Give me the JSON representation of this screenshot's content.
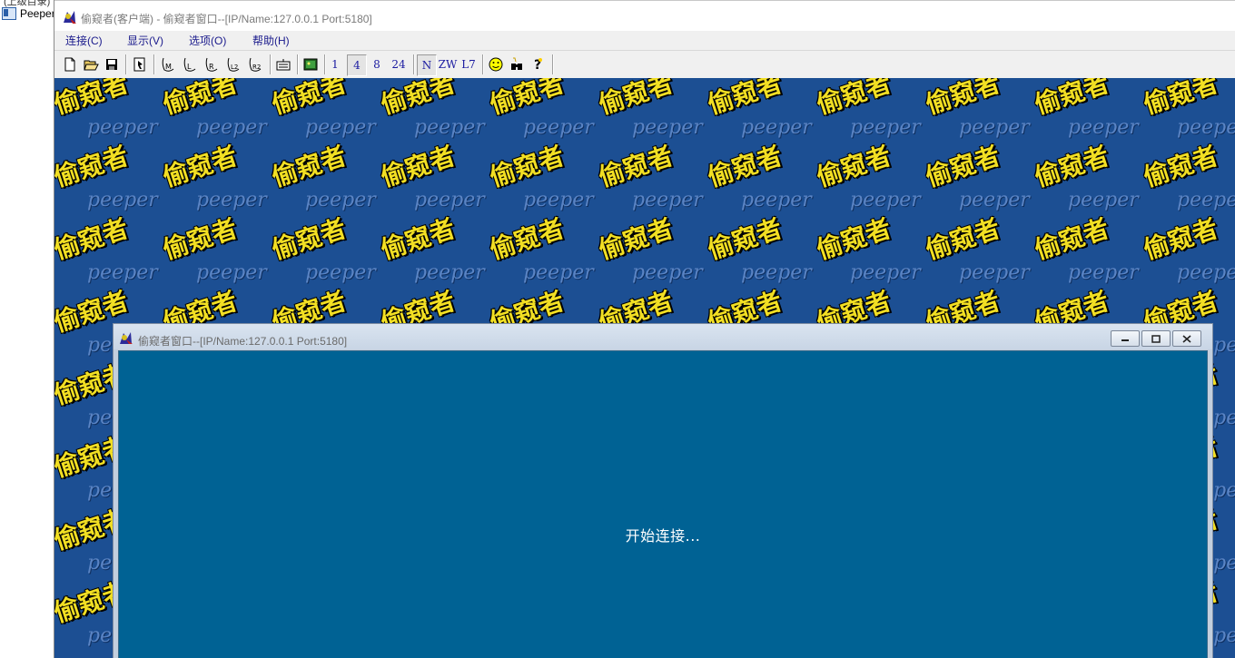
{
  "left_panel": {
    "top_item": "(上级目录)",
    "item_label": "Peeper"
  },
  "app": {
    "title": "偷窥者(客户端) - 偷窥者窗口--[IP/Name:127.0.0.1  Port:5180]",
    "menu": [
      {
        "label": "连接(C)"
      },
      {
        "label": "显示(V)"
      },
      {
        "label": "选项(O)"
      },
      {
        "label": "帮助(H)"
      }
    ],
    "toolbar": {
      "interval_1": "1",
      "interval_4": "4",
      "interval_8": "8",
      "interval_24": "24",
      "mode_n": "N",
      "mode_zw": "ZW",
      "mode_l7": "L7"
    }
  },
  "wallpaper": {
    "brand_cn": "偷窥者",
    "brand_en": "peeper"
  },
  "child_window": {
    "title": "偷窥者窗口--[IP/Name:127.0.0.1  Port:5180]",
    "status": "开始连接..."
  },
  "colors": {
    "wallpaper_bg": "#1c4f93",
    "brand_yellow": "#f2df23",
    "child_body": "#006294",
    "menu_text": "#1a1a8c"
  }
}
